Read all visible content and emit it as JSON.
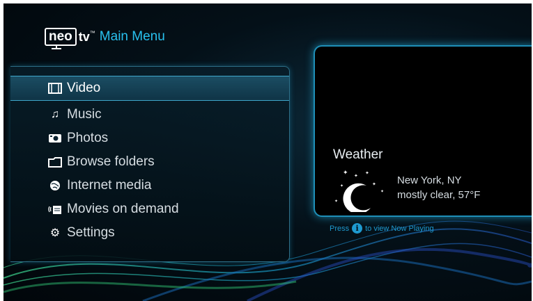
{
  "header": {
    "logo_neo": "neo",
    "logo_tv": "tv",
    "logo_tm": "™",
    "title": "Main Menu"
  },
  "menu": {
    "items": [
      {
        "label": "Video",
        "icon": "film-icon",
        "selected": true
      },
      {
        "label": "Music",
        "icon": "music-note-icon",
        "selected": false
      },
      {
        "label": "Photos",
        "icon": "camera-icon",
        "selected": false
      },
      {
        "label": "Browse folders",
        "icon": "folder-icon",
        "selected": false
      },
      {
        "label": "Internet media",
        "icon": "globe-icon",
        "selected": false
      },
      {
        "label": "Movies on demand",
        "icon": "streaming-icon",
        "selected": false
      },
      {
        "label": "Settings",
        "icon": "gears-icon",
        "selected": false
      }
    ]
  },
  "weather": {
    "title": "Weather",
    "location": "New York, NY",
    "condition": "mostly clear, 57°F",
    "icon": "moon-stars-icon"
  },
  "hint": {
    "before": "Press",
    "button": "i",
    "after": "to view Now Playing"
  },
  "colors": {
    "accent": "#28c0ee",
    "panel_border": "#1e8fb8"
  }
}
